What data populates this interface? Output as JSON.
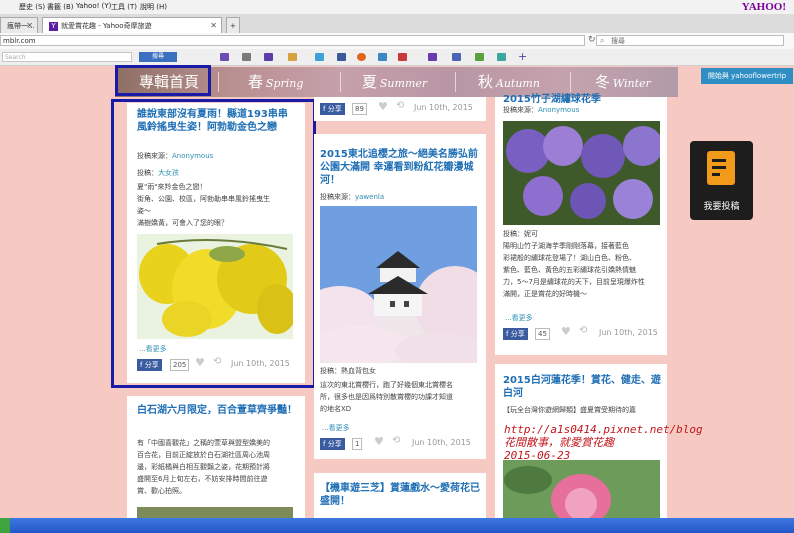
{
  "browser": {
    "menu": [
      "歷史 (S)",
      "書籤 (B)",
      "Yahoo! (Y)",
      "工具 (T)",
      "說明 (H)"
    ],
    "brand": "YAHOO!",
    "tabs": [
      {
        "label": "瘋帶一..."
      },
      {
        "label": "就愛賞花趣 - Yahoo奇摩旅遊"
      }
    ],
    "address": "mblr.com",
    "search_placeholder": "搜尋",
    "toolbar_search_button": "搜尋"
  },
  "nav": {
    "home": "專輯首頁",
    "seasons": [
      {
        "zh": "春",
        "en": "Spring"
      },
      {
        "zh": "夏",
        "en": "Summer"
      },
      {
        "zh": "秋",
        "en": "Autumn"
      },
      {
        "zh": "冬",
        "en": "Winter"
      }
    ]
  },
  "start_button": "開始與 yahooflowertrip",
  "submit_label": "我要投稿",
  "col1": {
    "card1": {
      "title": "誰說東部沒有夏雨！縣道193串串風鈴搖曳生姿！阿勃勒金色之戀",
      "source_label": "投稿來源：",
      "source": "Anonymous",
      "poster_label": "投稿：",
      "poster": "大女孩",
      "lines": [
        "夏\"雨\"來羚金色之戀！",
        "街角、公園、校區，阿勃勒串串風鈴搖曳生",
        "姿～",
        "滿樹嬌黃，可會入了您的眼？"
      ],
      "more": "...看更多",
      "share": "分享",
      "count": "205",
      "date": "Jun 10th, 2015"
    },
    "card2": {
      "title": "白石湖六月限定，百合萱草齊爭豔！",
      "lines": [
        "有「中國喜觀花」之稱的萱草與盟型嬌美的",
        "百合花，目前正綻放於白石湖社區周心池周",
        "邊，彩紙橘與白相互觀豔之姿，花期預計將",
        "盛開至6月上旬左右，不妨安排時間前往遊",
        "賞、歡心拍照。"
      ]
    }
  },
  "col2": {
    "card0": {
      "share": "分享",
      "count": "89",
      "date": "Jun 10th, 2015"
    },
    "card1": {
      "title": "2015東北追櫻之旅～絕美名勝弘前公園大滿開 幸運看到粉紅花瓣漫城河！",
      "source_label": "投稿來源：",
      "source": "yawenla",
      "poster_label": "投稿：",
      "poster": "熱血背包女",
      "lines": [
        "這次的東北賞櫻行，跑了好幾個東北賞櫻名",
        "所，很多也是因爲特別散賞櫻的功課才知道",
        "的地名XD"
      ],
      "more": "...看更多",
      "share": "分享",
      "count": "1",
      "date": "Jun 10th, 2015"
    },
    "card2": {
      "title": "【機車遊三芝】賞蓮戲水～愛荷花已盛開！"
    }
  },
  "col3": {
    "card1": {
      "title": "2015竹子湖繡球花季",
      "source_label": "投稿來源：",
      "source": "Anonymous",
      "poster_label": "投稿：",
      "poster": "妮可",
      "lines": [
        "陽明山竹子湖海芋季剛剛落幕，接著藍色",
        "彩裙般的繡球花登場了！湖山白色、粉色、",
        "紫色、藍色、黃色的五彩繡球花引嬌熱情魅",
        "力，5～7月是繡球花的天下，目前呈現爆炸性",
        "滿開，正是賞花的好時機～"
      ],
      "more": "...看更多",
      "share": "分享",
      "count": "45",
      "date": "Jun 10th, 2015"
    },
    "card2": {
      "title": "2015白河蓮花季！賞花、健走、遊白河",
      "lines": [
        "【玩全台灣你遊網歸類】盛夏賞受期待的嘉"
      ]
    }
  },
  "watermark": [
    "http://a1s0414.pixnet.net/blog",
    "花間散事，就愛賞花趣",
    "2015-06-23"
  ]
}
